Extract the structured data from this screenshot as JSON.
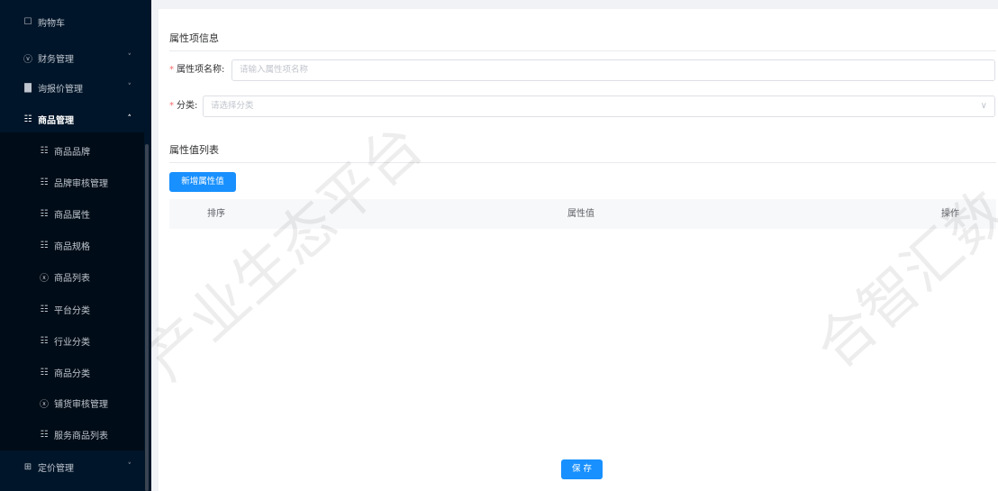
{
  "sidebar": {
    "top_items": [
      {
        "label": "购物车",
        "icon": "cart-icon",
        "glyph": "☐"
      },
      {
        "label": "财务管理",
        "icon": "finance-icon",
        "glyph": "ⓥ"
      },
      {
        "label": "询报价管理",
        "icon": "chart-icon",
        "glyph": "▇"
      },
      {
        "label": "商品管理",
        "icon": "grid-icon",
        "glyph": "☷"
      }
    ],
    "sub_items": [
      {
        "label": "商品品牌",
        "icon": "grid-icon",
        "glyph": "☷"
      },
      {
        "label": "品牌审核管理",
        "icon": "grid-icon",
        "glyph": "☷"
      },
      {
        "label": "商品属性",
        "icon": "grid-icon",
        "glyph": "☷"
      },
      {
        "label": "商品规格",
        "icon": "grid-icon",
        "glyph": "☷"
      },
      {
        "label": "商品列表",
        "icon": "help-circle-icon",
        "glyph": "ⓧ"
      },
      {
        "label": "平台分类",
        "icon": "grid-icon",
        "glyph": "☷"
      },
      {
        "label": "行业分类",
        "icon": "grid-icon",
        "glyph": "☷"
      },
      {
        "label": "商品分类",
        "icon": "grid-icon",
        "glyph": "☷"
      },
      {
        "label": "铺货审核管理",
        "icon": "help-circle-icon",
        "glyph": "ⓧ"
      },
      {
        "label": "服务商品列表",
        "icon": "grid-icon",
        "glyph": "☷"
      }
    ],
    "bottom_item": {
      "label": "定价管理",
      "icon": "table-icon",
      "glyph": "⊞"
    },
    "arrow_down": "˅",
    "arrow_up": "˄"
  },
  "main": {
    "section1_title": "属性项信息",
    "required_mark": "*",
    "name_label": "属性项名称:",
    "name_placeholder": "请输入属性项名称",
    "category_label": "分类:",
    "category_placeholder": "请选择分类",
    "select_arrow": "∨",
    "section2_title": "属性值列表",
    "add_button": "新增属性值",
    "table_columns": [
      "排序",
      "属性值",
      "操作"
    ],
    "save_button": "保 存"
  },
  "watermark": {
    "text1": "产业生态平台",
    "text2": "合智汇数"
  },
  "colors": {
    "sidebar_bg": "#001529",
    "primary": "#1890ff",
    "required": "#f56c6c"
  }
}
